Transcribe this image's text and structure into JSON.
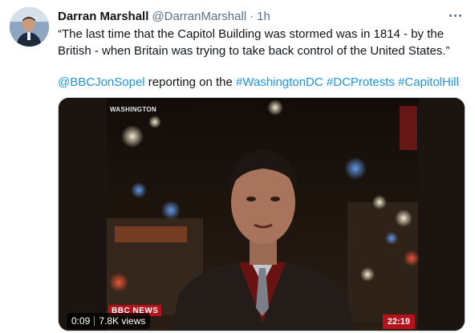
{
  "tweet": {
    "author_name": "Darran Marshall",
    "handle": "@DarranMarshall",
    "separator": "·",
    "time": "1h",
    "text": "“The last time that the Capitol Building was stormed was in 1814 - by the British - when Britain was trying to take back control of the United States.”",
    "mention": "@BBCJonSopel",
    "mid_text": " reporting on the ",
    "hashtags": [
      "#WashingtonDC",
      "#DCProtests",
      "#CapitolHill"
    ]
  },
  "video": {
    "location_caption": "WASHINGTON",
    "channel_logo": "BBC NEWS",
    "clock": "22:19",
    "duration": "0:09",
    "views": "7.8K views"
  },
  "colors": {
    "link": "#1b95e0",
    "secondary_text": "#5b7083",
    "bbc_red": "#b5121b"
  },
  "icons": {
    "more": "more-dots-icon"
  }
}
